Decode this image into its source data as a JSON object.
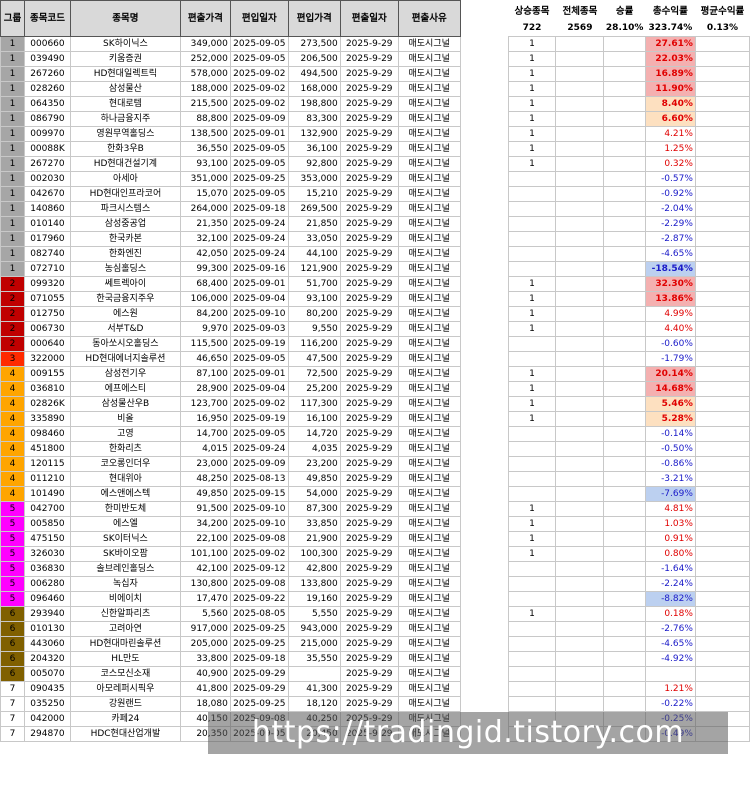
{
  "headers": {
    "group": "그룹",
    "code": "종목코드",
    "name": "종목명",
    "price_in": "편출가격",
    "date_in": "편입일자",
    "price_out": "편입가격",
    "date_out": "편출일자",
    "reason": "편출사유"
  },
  "stats": {
    "up_label": "상승종목",
    "total_label": "전체종목",
    "winrate_label": "승률",
    "total_return_label": "총수익률",
    "avg_return_label": "평균수익률",
    "up_value": "722",
    "total_value": "2569",
    "winrate_value": "28.10%",
    "total_return_value": "323.74%",
    "avg_return_value": "0.13%"
  },
  "group_colors": {
    "1": "#a6a6a6",
    "2": "#c00000",
    "3": "#ff2a00",
    "4": "#ffa500",
    "5": "#ff00ff",
    "6": "#806000",
    "7": "#ffffff"
  },
  "rows": [
    {
      "g": "1",
      "code": "000660",
      "name": "SK하이닉스",
      "p1": "349,000",
      "d1": "2025-09-05",
      "p2": "273,500",
      "d2": "2025-9-29",
      "reason": "매도시그널",
      "up": "1",
      "ret": "27.61%",
      "bg": "#f4b0b0",
      "bold": true,
      "neg": false
    },
    {
      "g": "1",
      "code": "039490",
      "name": "키움증권",
      "p1": "252,000",
      "d1": "2025-09-05",
      "p2": "206,500",
      "d2": "2025-9-29",
      "reason": "매도시그널",
      "up": "1",
      "ret": "22.03%",
      "bg": "#f4b0b0",
      "bold": true,
      "neg": false
    },
    {
      "g": "1",
      "code": "267260",
      "name": "HD현대일렉트릭",
      "p1": "578,000",
      "d1": "2025-09-02",
      "p2": "494,500",
      "d2": "2025-9-29",
      "reason": "매도시그널",
      "up": "1",
      "ret": "16.89%",
      "bg": "#f4b0b0",
      "bold": true,
      "neg": false
    },
    {
      "g": "1",
      "code": "028260",
      "name": "삼성물산",
      "p1": "188,000",
      "d1": "2025-09-02",
      "p2": "168,000",
      "d2": "2025-9-29",
      "reason": "매도시그널",
      "up": "1",
      "ret": "11.90%",
      "bg": "#f4b0b0",
      "bold": true,
      "neg": false
    },
    {
      "g": "1",
      "code": "064350",
      "name": "현대로템",
      "p1": "215,500",
      "d1": "2025-09-02",
      "p2": "198,800",
      "d2": "2025-9-29",
      "reason": "매도시그널",
      "up": "1",
      "ret": "8.40%",
      "bg": "#fde0c0",
      "bold": true,
      "neg": false
    },
    {
      "g": "1",
      "code": "086790",
      "name": "하나금융지주",
      "p1": "88,800",
      "d1": "2025-09-09",
      "p2": "83,300",
      "d2": "2025-9-29",
      "reason": "매도시그널",
      "up": "1",
      "ret": "6.60%",
      "bg": "#fde0c0",
      "bold": true,
      "neg": false
    },
    {
      "g": "1",
      "code": "009970",
      "name": "영원무역홀딩스",
      "p1": "138,500",
      "d1": "2025-09-01",
      "p2": "132,900",
      "d2": "2025-9-29",
      "reason": "매도시그널",
      "up": "1",
      "ret": "4.21%",
      "bg": "",
      "bold": false,
      "neg": false
    },
    {
      "g": "1",
      "code": "00088K",
      "name": "한화3우B",
      "p1": "36,550",
      "d1": "2025-09-05",
      "p2": "36,100",
      "d2": "2025-9-29",
      "reason": "매도시그널",
      "up": "1",
      "ret": "1.25%",
      "bg": "",
      "bold": false,
      "neg": false
    },
    {
      "g": "1",
      "code": "267270",
      "name": "HD현대건설기계",
      "p1": "93,100",
      "d1": "2025-09-05",
      "p2": "92,800",
      "d2": "2025-9-29",
      "reason": "매도시그널",
      "up": "1",
      "ret": "0.32%",
      "bg": "",
      "bold": false,
      "neg": false
    },
    {
      "g": "1",
      "code": "002030",
      "name": "아세아",
      "p1": "351,000",
      "d1": "2025-09-25",
      "p2": "353,000",
      "d2": "2025-9-29",
      "reason": "매도시그널",
      "up": "",
      "ret": "-0.57%",
      "bg": "",
      "bold": false,
      "neg": true
    },
    {
      "g": "1",
      "code": "042670",
      "name": "HD현대인프라코어",
      "p1": "15,070",
      "d1": "2025-09-05",
      "p2": "15,210",
      "d2": "2025-9-29",
      "reason": "매도시그널",
      "up": "",
      "ret": "-0.92%",
      "bg": "",
      "bold": false,
      "neg": true
    },
    {
      "g": "1",
      "code": "140860",
      "name": "파크시스템스",
      "p1": "264,000",
      "d1": "2025-09-18",
      "p2": "269,500",
      "d2": "2025-9-29",
      "reason": "매도시그널",
      "up": "",
      "ret": "-2.04%",
      "bg": "",
      "bold": false,
      "neg": true
    },
    {
      "g": "1",
      "code": "010140",
      "name": "삼성중공업",
      "p1": "21,350",
      "d1": "2025-09-24",
      "p2": "21,850",
      "d2": "2025-9-29",
      "reason": "매도시그널",
      "up": "",
      "ret": "-2.29%",
      "bg": "",
      "bold": false,
      "neg": true
    },
    {
      "g": "1",
      "code": "017960",
      "name": "한국카본",
      "p1": "32,100",
      "d1": "2025-09-24",
      "p2": "33,050",
      "d2": "2025-9-29",
      "reason": "매도시그널",
      "up": "",
      "ret": "-2.87%",
      "bg": "",
      "bold": false,
      "neg": true
    },
    {
      "g": "1",
      "code": "082740",
      "name": "한화엔진",
      "p1": "42,050",
      "d1": "2025-09-24",
      "p2": "44,100",
      "d2": "2025-9-29",
      "reason": "매도시그널",
      "up": "",
      "ret": "-4.65%",
      "bg": "",
      "bold": false,
      "neg": true
    },
    {
      "g": "1",
      "code": "072710",
      "name": "농심홀딩스",
      "p1": "99,300",
      "d1": "2025-09-16",
      "p2": "121,900",
      "d2": "2025-9-29",
      "reason": "매도시그널",
      "up": "",
      "ret": "-18.54%",
      "bg": "#bcd0f0",
      "bold": true,
      "neg": true
    },
    {
      "g": "2",
      "code": "099320",
      "name": "쎄트렉아이",
      "p1": "68,400",
      "d1": "2025-09-01",
      "p2": "51,700",
      "d2": "2025-9-29",
      "reason": "매도시그널",
      "up": "1",
      "ret": "32.30%",
      "bg": "#f4b0b0",
      "bold": true,
      "neg": false
    },
    {
      "g": "2",
      "code": "071055",
      "name": "한국금융지주우",
      "p1": "106,000",
      "d1": "2025-09-04",
      "p2": "93,100",
      "d2": "2025-9-29",
      "reason": "매도시그널",
      "up": "1",
      "ret": "13.86%",
      "bg": "#f4b0b0",
      "bold": true,
      "neg": false
    },
    {
      "g": "2",
      "code": "012750",
      "name": "에스원",
      "p1": "84,200",
      "d1": "2025-09-10",
      "p2": "80,200",
      "d2": "2025-9-29",
      "reason": "매도시그널",
      "up": "1",
      "ret": "4.99%",
      "bg": "",
      "bold": false,
      "neg": false
    },
    {
      "g": "2",
      "code": "006730",
      "name": "서부T&D",
      "p1": "9,970",
      "d1": "2025-09-03",
      "p2": "9,550",
      "d2": "2025-9-29",
      "reason": "매도시그널",
      "up": "1",
      "ret": "4.40%",
      "bg": "",
      "bold": false,
      "neg": false
    },
    {
      "g": "2",
      "code": "000640",
      "name": "동아쏘시오홀딩스",
      "p1": "115,500",
      "d1": "2025-09-19",
      "p2": "116,200",
      "d2": "2025-9-29",
      "reason": "매도시그널",
      "up": "",
      "ret": "-0.60%",
      "bg": "",
      "bold": false,
      "neg": true
    },
    {
      "g": "3",
      "code": "322000",
      "name": "HD현대에너지솔루션",
      "p1": "46,650",
      "d1": "2025-09-05",
      "p2": "47,500",
      "d2": "2025-9-29",
      "reason": "매도시그널",
      "up": "",
      "ret": "-1.79%",
      "bg": "",
      "bold": false,
      "neg": true
    },
    {
      "g": "4",
      "code": "009155",
      "name": "삼성전기우",
      "p1": "87,100",
      "d1": "2025-09-01",
      "p2": "72,500",
      "d2": "2025-9-29",
      "reason": "매도시그널",
      "up": "1",
      "ret": "20.14%",
      "bg": "#f4b0b0",
      "bold": true,
      "neg": false
    },
    {
      "g": "4",
      "code": "036810",
      "name": "에프에스티",
      "p1": "28,900",
      "d1": "2025-09-04",
      "p2": "25,200",
      "d2": "2025-9-29",
      "reason": "매도시그널",
      "up": "1",
      "ret": "14.68%",
      "bg": "#f4b0b0",
      "bold": true,
      "neg": false
    },
    {
      "g": "4",
      "code": "02826K",
      "name": "삼성물산우B",
      "p1": "123,700",
      "d1": "2025-09-02",
      "p2": "117,300",
      "d2": "2025-9-29",
      "reason": "매도시그널",
      "up": "1",
      "ret": "5.46%",
      "bg": "#fde0c0",
      "bold": true,
      "neg": false
    },
    {
      "g": "4",
      "code": "335890",
      "name": "비올",
      "p1": "16,950",
      "d1": "2025-09-19",
      "p2": "16,100",
      "d2": "2025-9-29",
      "reason": "매도시그널",
      "up": "1",
      "ret": "5.28%",
      "bg": "#fde0c0",
      "bold": true,
      "neg": false
    },
    {
      "g": "4",
      "code": "098460",
      "name": "고영",
      "p1": "14,700",
      "d1": "2025-09-05",
      "p2": "14,720",
      "d2": "2025-9-29",
      "reason": "매도시그널",
      "up": "",
      "ret": "-0.14%",
      "bg": "",
      "bold": false,
      "neg": true
    },
    {
      "g": "4",
      "code": "451800",
      "name": "한화리츠",
      "p1": "4,015",
      "d1": "2025-09-24",
      "p2": "4,035",
      "d2": "2025-9-29",
      "reason": "매도시그널",
      "up": "",
      "ret": "-0.50%",
      "bg": "",
      "bold": false,
      "neg": true
    },
    {
      "g": "4",
      "code": "120115",
      "name": "코오롱인더우",
      "p1": "23,000",
      "d1": "2025-09-09",
      "p2": "23,200",
      "d2": "2025-9-29",
      "reason": "매도시그널",
      "up": "",
      "ret": "-0.86%",
      "bg": "",
      "bold": false,
      "neg": true
    },
    {
      "g": "4",
      "code": "011210",
      "name": "현대위아",
      "p1": "48,250",
      "d1": "2025-08-13",
      "p2": "49,850",
      "d2": "2025-9-29",
      "reason": "매도시그널",
      "up": "",
      "ret": "-3.21%",
      "bg": "",
      "bold": false,
      "neg": true
    },
    {
      "g": "4",
      "code": "101490",
      "name": "에스앤에스텍",
      "p1": "49,850",
      "d1": "2025-09-15",
      "p2": "54,000",
      "d2": "2025-9-29",
      "reason": "매도시그널",
      "up": "",
      "ret": "-7.69%",
      "bg": "#bcd0f0",
      "bold": false,
      "neg": true
    },
    {
      "g": "5",
      "code": "042700",
      "name": "한미반도체",
      "p1": "91,500",
      "d1": "2025-09-10",
      "p2": "87,300",
      "d2": "2025-9-29",
      "reason": "매도시그널",
      "up": "1",
      "ret": "4.81%",
      "bg": "",
      "bold": false,
      "neg": false
    },
    {
      "g": "5",
      "code": "005850",
      "name": "에스엘",
      "p1": "34,200",
      "d1": "2025-09-10",
      "p2": "33,850",
      "d2": "2025-9-29",
      "reason": "매도시그널",
      "up": "1",
      "ret": "1.03%",
      "bg": "",
      "bold": false,
      "neg": false
    },
    {
      "g": "5",
      "code": "475150",
      "name": "SK이터닉스",
      "p1": "22,100",
      "d1": "2025-09-08",
      "p2": "21,900",
      "d2": "2025-9-29",
      "reason": "매도시그널",
      "up": "1",
      "ret": "0.91%",
      "bg": "",
      "bold": false,
      "neg": false
    },
    {
      "g": "5",
      "code": "326030",
      "name": "SK바이오팜",
      "p1": "101,100",
      "d1": "2025-09-02",
      "p2": "100,300",
      "d2": "2025-9-29",
      "reason": "매도시그널",
      "up": "1",
      "ret": "0.80%",
      "bg": "",
      "bold": false,
      "neg": false
    },
    {
      "g": "5",
      "code": "036830",
      "name": "솔브레인홀딩스",
      "p1": "42,100",
      "d1": "2025-09-12",
      "p2": "42,800",
      "d2": "2025-9-29",
      "reason": "매도시그널",
      "up": "",
      "ret": "-1.64%",
      "bg": "",
      "bold": false,
      "neg": true
    },
    {
      "g": "5",
      "code": "006280",
      "name": "녹십자",
      "p1": "130,800",
      "d1": "2025-09-08",
      "p2": "133,800",
      "d2": "2025-9-29",
      "reason": "매도시그널",
      "up": "",
      "ret": "-2.24%",
      "bg": "",
      "bold": false,
      "neg": true
    },
    {
      "g": "5",
      "code": "096460",
      "name": "비에이치",
      "p1": "17,470",
      "d1": "2025-09-22",
      "p2": "19,160",
      "d2": "2025-9-29",
      "reason": "매도시그널",
      "up": "",
      "ret": "-8.82%",
      "bg": "#bcd0f0",
      "bold": false,
      "neg": true
    },
    {
      "g": "6",
      "code": "293940",
      "name": "신한알파리츠",
      "p1": "5,560",
      "d1": "2025-08-05",
      "p2": "5,550",
      "d2": "2025-9-29",
      "reason": "매도시그널",
      "up": "1",
      "ret": "0.18%",
      "bg": "",
      "bold": false,
      "neg": false
    },
    {
      "g": "6",
      "code": "010130",
      "name": "고려아연",
      "p1": "917,000",
      "d1": "2025-09-25",
      "p2": "943,000",
      "d2": "2025-9-29",
      "reason": "매도시그널",
      "up": "",
      "ret": "-2.76%",
      "bg": "",
      "bold": false,
      "neg": true
    },
    {
      "g": "6",
      "code": "443060",
      "name": "HD현대마린솔루션",
      "p1": "205,000",
      "d1": "2025-09-25",
      "p2": "215,000",
      "d2": "2025-9-29",
      "reason": "매도시그널",
      "up": "",
      "ret": "-4.65%",
      "bg": "",
      "bold": false,
      "neg": true
    },
    {
      "g": "6",
      "code": "204320",
      "name": "HL만도",
      "p1": "33,800",
      "d1": "2025-09-18",
      "p2": "35,550",
      "d2": "2025-9-29",
      "reason": "매도시그널",
      "up": "",
      "ret": "-4.92%",
      "bg": "",
      "bold": false,
      "neg": true
    },
    {
      "g": "6",
      "code": "005070",
      "name": "코스모신소재",
      "p1": "40,900",
      "d1": "2025-09-29",
      "p2": "",
      "d2": "2025-9-29",
      "reason": "매도시그널",
      "up": "",
      "ret": "",
      "bg": "",
      "bold": false,
      "neg": true
    },
    {
      "g": "7",
      "code": "090435",
      "name": "아모레퍼시픽우",
      "p1": "41,800",
      "d1": "2025-09-29",
      "p2": "41,300",
      "d2": "2025-9-29",
      "reason": "매도시그널",
      "up": "",
      "ret": "1.21%",
      "bg": "",
      "bold": false,
      "neg": false
    },
    {
      "g": "7",
      "code": "035250",
      "name": "강원랜드",
      "p1": "18,080",
      "d1": "2025-09-25",
      "p2": "18,120",
      "d2": "2025-9-29",
      "reason": "매도시그널",
      "up": "",
      "ret": "-0.22%",
      "bg": "",
      "bold": false,
      "neg": true
    },
    {
      "g": "7",
      "code": "042000",
      "name": "카페24",
      "p1": "40,150",
      "d1": "2025-09-08",
      "p2": "40,250",
      "d2": "2025-9-29",
      "reason": "매도시그널",
      "up": "",
      "ret": "-0.25%",
      "bg": "",
      "bold": false,
      "neg": true
    },
    {
      "g": "7",
      "code": "294870",
      "name": "HDC현대산업개발",
      "p1": "20,350",
      "d1": "2025-09-05",
      "p2": "20,450",
      "d2": "2025-9-29",
      "reason": "매도시그널",
      "up": "",
      "ret": "-0.49%",
      "bg": "",
      "bold": false,
      "neg": true
    }
  ],
  "watermark": "https://tradingid.tistory.com"
}
